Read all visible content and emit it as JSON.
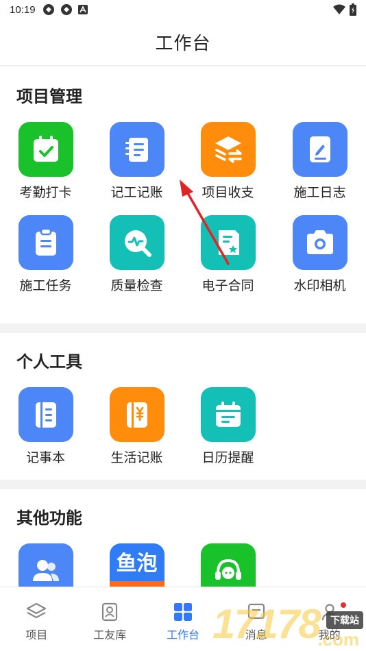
{
  "status": {
    "time": "10:19"
  },
  "header": {
    "title": "工作台"
  },
  "sections": {
    "project": {
      "title": "项目管理",
      "items": [
        "考勤打卡",
        "记工记账",
        "项目收支",
        "施工日志",
        "施工任务",
        "质量检查",
        "电子合同",
        "水印相机"
      ]
    },
    "personal": {
      "title": "个人工具",
      "items": [
        "记事本",
        "生活记账",
        "日历提醒"
      ]
    },
    "other": {
      "title": "其他功能",
      "fish_logo_text": "鱼泡"
    }
  },
  "tabs": [
    "项目",
    "工友库",
    "工作台",
    "消息",
    "我的"
  ],
  "active_tab": "工作台",
  "watermark": {
    "number": "17178",
    "badge": "下载站",
    "suffix": ".com"
  },
  "colors": {
    "green": "#19c22a",
    "blue": "#4d86f7",
    "orange": "#ff8c0a",
    "teal": "#14bfb6",
    "accent": "#3478f6"
  }
}
